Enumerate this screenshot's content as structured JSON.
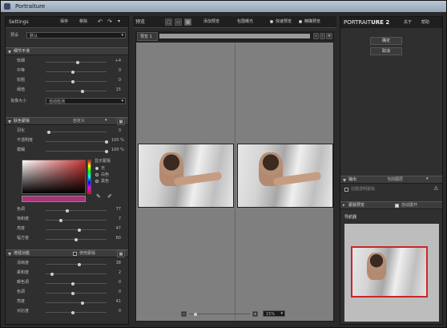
{
  "window": {
    "title": "Portraiture"
  },
  "left": {
    "settings_label": "Settings",
    "save": "保存",
    "delete": "移除",
    "undo_icon": "undo-icon",
    "redo_icon": "redo-icon",
    "preset_label": "预设",
    "preset_value": "默认",
    "detail_section": "细节平滑",
    "detail_rows": [
      {
        "label": "较细",
        "value": "+4",
        "knob": 0.52
      },
      {
        "label": "中等",
        "value": "0",
        "knob": 0.45
      },
      {
        "label": "较粗",
        "value": "0",
        "knob": 0.45
      },
      {
        "label": "阈值",
        "value": "15",
        "knob": 0.6
      }
    ],
    "portrait_size_label": "肖像大小",
    "portrait_size_value": "自动检测",
    "skin_section": "肤色蒙版",
    "skin_mode": "自定义",
    "skin_rows": [
      {
        "label": "羽化",
        "value": "0",
        "knob": 0.05
      },
      {
        "label": "不透明度",
        "value": "100 %",
        "knob": 1.0
      },
      {
        "label": "模糊",
        "value": "100 %",
        "knob": 1.0
      }
    ],
    "mask_display_label": "显示蒙版",
    "mask_options": [
      "无",
      "白色",
      "黑色"
    ],
    "mask_selected": 0,
    "skin_tone_rows": [
      {
        "label": "色调",
        "value": "77",
        "knob": 0.35
      },
      {
        "label": "饱和度",
        "value": "7",
        "knob": 0.25
      },
      {
        "label": "亮度",
        "value": "47",
        "knob": 0.55
      },
      {
        "label": "幅方度",
        "value": "60",
        "knob": 0.5
      }
    ],
    "enhance_section": "增强功能",
    "use_mask_label": "使用蒙版",
    "enhance_rows": [
      {
        "label": "清晰度",
        "value": "38",
        "knob": 0.55
      },
      {
        "label": "柔和度",
        "value": "2",
        "knob": 0.1
      },
      {
        "label": "暖色调",
        "value": "0",
        "knob": 0.45
      },
      {
        "label": "色调",
        "value": "0",
        "knob": 0.45
      },
      {
        "label": "亮度",
        "value": "41",
        "knob": 0.6
      },
      {
        "label": "对比度",
        "value": "0",
        "knob": 0.45
      }
    ]
  },
  "center": {
    "preview_label": "预览",
    "add_preview": "添加预览",
    "crop_exposure": "包围曝光",
    "fast_preview": "快速预览",
    "accurate_preview": "精确预览",
    "tab_label": "预览 1",
    "zoom": "15%"
  },
  "right": {
    "brand_light": "PORTRAIT",
    "brand_bold": "URE 2",
    "about": "关于",
    "help": "帮助",
    "ok": "确定",
    "cancel": "取消",
    "output_label": "输出",
    "output_value": "当前图层",
    "create_transparent": "创建透明蒙版",
    "mask_preview": "蒙版预览",
    "auto_expand": "自动展开",
    "navigator": "导航器"
  },
  "colors": {
    "accent_red": "#c9272b",
    "panel": "#2f2f2f",
    "viewer": "#7f7f7f"
  }
}
